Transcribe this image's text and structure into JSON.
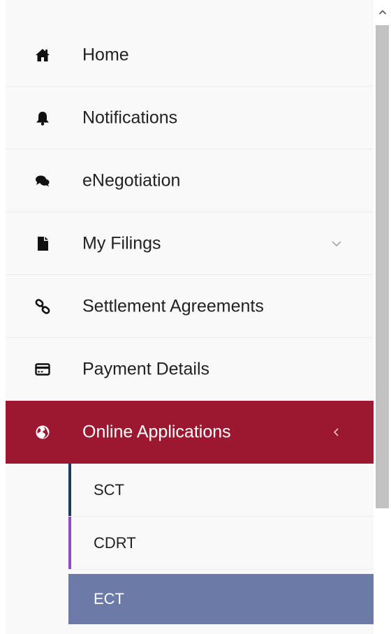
{
  "menu": {
    "items": [
      {
        "label": "Home",
        "icon": "home-icon"
      },
      {
        "label": "Notifications",
        "icon": "bell-icon"
      },
      {
        "label": "eNegotiation",
        "icon": "comments-icon"
      },
      {
        "label": "My Filings",
        "icon": "file-icon",
        "expander": "chevron-down-icon"
      },
      {
        "label": "Settlement Agreements",
        "icon": "link-icon"
      },
      {
        "label": "Payment Details",
        "icon": "credit-card-icon"
      },
      {
        "label": "Online Applications",
        "icon": "globe-icon",
        "expander": "chevron-left-icon",
        "active": true
      }
    ],
    "subitems": [
      {
        "label": "SCT",
        "accent": "#1f3b5c"
      },
      {
        "label": "CDRT",
        "accent": "#8a4fc4"
      },
      {
        "label": "ECT",
        "selected": true
      }
    ]
  },
  "colors": {
    "active_bg": "#9b1830",
    "selected_sub_bg": "#6b7aa6",
    "sidebar_bg": "#f9f9f9",
    "scroll_thumb": "#c2c2c2"
  }
}
